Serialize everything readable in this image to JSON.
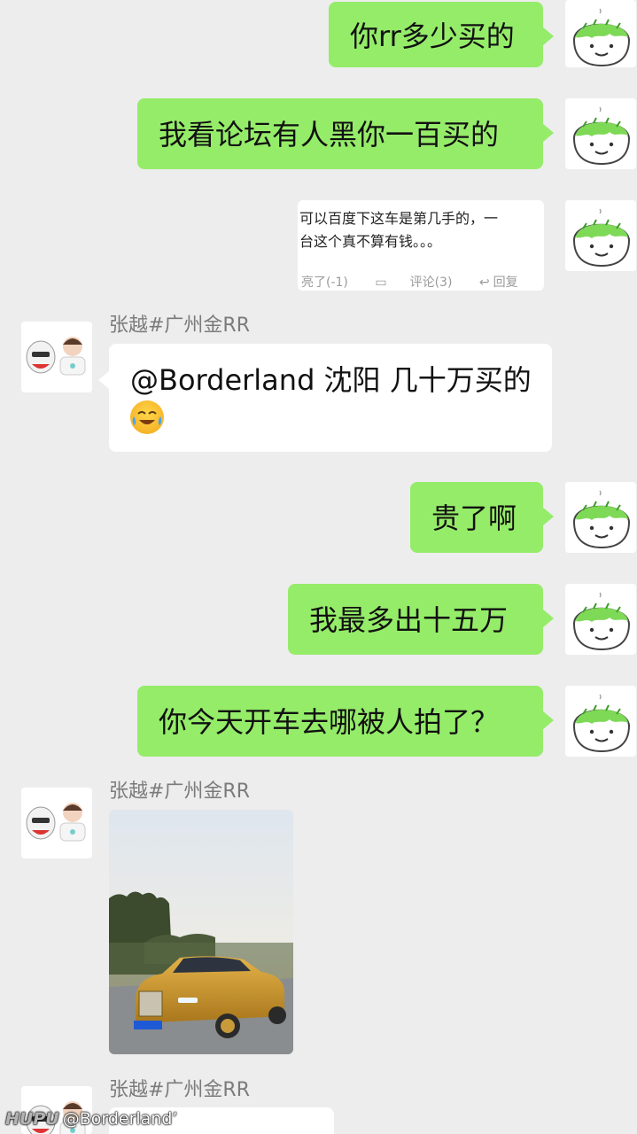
{
  "messages": {
    "m1": "你rr多少买的",
    "m2": "我看论坛有人黑你一百买的",
    "m3_card": {
      "line1": "可以百度下这车是第几手的，一",
      "line2": "台这个真不算有钱。。。",
      "like": "亮了(-1)",
      "comment": "评论(3)",
      "reply": "回复"
    },
    "m4_sender": "张越#广州金RR",
    "m4": "@Borderland 沈阳 几十万买的",
    "m5": "贵了啊",
    "m6": "我最多出十五万",
    "m7": "你今天开车去哪被人拍了？",
    "m8_sender": "张越#广州金RR",
    "m9_sender": "张越#广州金RR"
  },
  "watermark": {
    "logo": "HUPU",
    "user": "@Borderland’"
  },
  "icons": {
    "self_avatar": "green-dumpling-face-avatar",
    "other_avatar": "stormtrooper-and-man-avatar",
    "emoji": "crying-laughing-emoji",
    "thumb": "thumb-icon",
    "comment": "comment-icon",
    "reply": "reply-arrow-icon"
  },
  "colors": {
    "outgoing_bubble": "#95ec69",
    "incoming_bubble": "#ffffff",
    "background": "#ededed"
  }
}
